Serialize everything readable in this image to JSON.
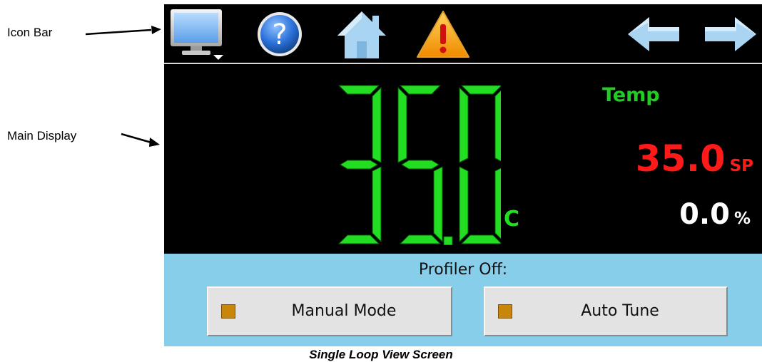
{
  "annotations": {
    "icon_bar_label": "Icon Bar",
    "main_display_label": "Main Display"
  },
  "icon_bar": {
    "icons": [
      "monitor-menu-icon",
      "help-icon",
      "home-icon",
      "alarm-warning-icon",
      "back-arrow-icon",
      "forward-arrow-icon"
    ]
  },
  "main_display": {
    "process_value": "35.0",
    "process_unit": "C",
    "loop_name": "Temp",
    "setpoint_value": "35.0",
    "setpoint_label": "SP",
    "output_value": "0.0",
    "output_unit": "%"
  },
  "bottom_panel": {
    "profiler_status": "Profiler Off:",
    "manual_mode_label": "Manual Mode",
    "auto_tune_label": "Auto Tune"
  },
  "caption": "Single Loop View Screen",
  "colors": {
    "process_value": "#22dd22",
    "setpoint": "#ff1a1a",
    "panel_background": "#87ceeb",
    "indicator": "#c8860a"
  }
}
